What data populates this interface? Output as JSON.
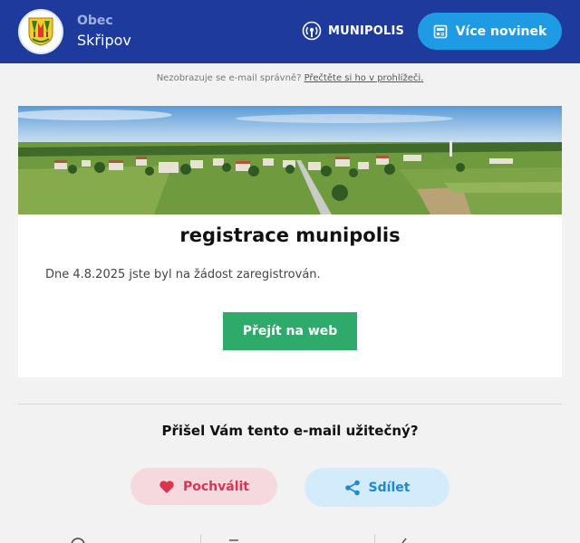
{
  "header": {
    "municipality_kind": "Obec",
    "municipality_name": "Skřipov",
    "brand_name": "MUNIPOLIS",
    "news_button_label": "Více novinek"
  },
  "preheader": {
    "text": "Nezobrazuje se e-mail správně?",
    "link": "Přečtěte si ho v prohlížeči."
  },
  "article": {
    "title": "registrace munipolis",
    "body": "Dne 4.8.2025 jste byl na žádost zaregistrován.",
    "button_label": "Přejít na web"
  },
  "feedback": {
    "question": "Přišel Vám tento e-mail užitečný?",
    "praise_label": "Pochválit",
    "share_label": "Sdílet"
  },
  "colors": {
    "header_bg": "#1d3a9c",
    "news_button": "#1f9be6",
    "web_button": "#2eaa6a",
    "praise": "#d93550",
    "share": "#1e8ad6"
  },
  "icons": [
    "coat-of-arms",
    "munipolis-logo-icon",
    "newspaper-icon",
    "heart-icon",
    "share-icon"
  ]
}
